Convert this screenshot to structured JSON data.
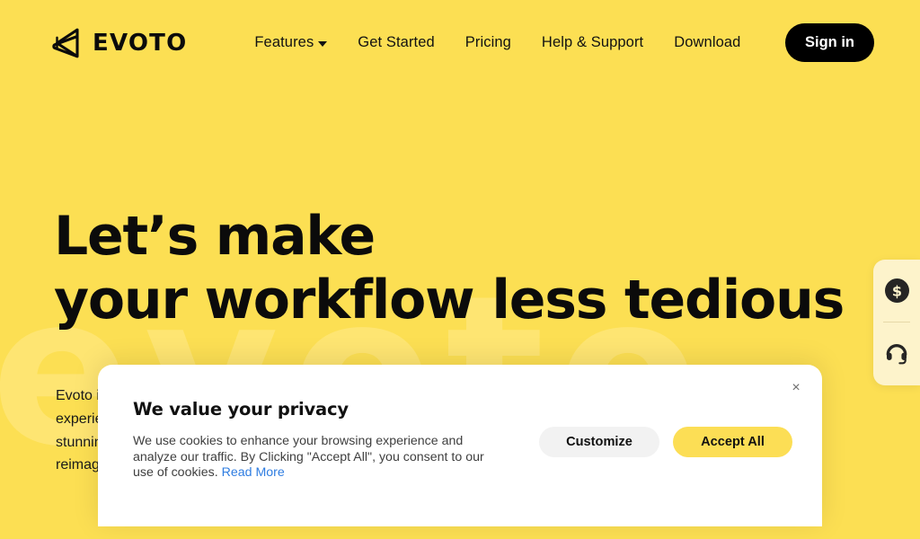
{
  "theme": {
    "brand_yellow": "#FCDF53",
    "watermark_yellow": "#FFE87D",
    "ink": "#0B0B0B",
    "link_blue": "#2F7DE1",
    "dock_cream": "#FDF3CB",
    "accept_yellow": "#FCDE55",
    "customize_grey": "#F2F2F2"
  },
  "background": {
    "watermark_text": "evoto"
  },
  "header": {
    "logo_text": "EVOTO",
    "logo_icon": "evoto-butterfly-mark",
    "nav": [
      {
        "label": "Features",
        "has_caret": true
      },
      {
        "label": "Get Started",
        "has_caret": false
      },
      {
        "label": "Pricing",
        "has_caret": false
      },
      {
        "label": "Help & Support",
        "has_caret": false
      },
      {
        "label": "Download",
        "has_caret": false
      }
    ],
    "signin_label": "Sign in"
  },
  "hero": {
    "line1": "Let’s make",
    "line2a": "your workflow",
    "line2b": "less tedious",
    "paragraph": "Evoto is an AI photo editor that redefines the photo editing experience, creating an enjoyable environment to generate stunning results and process photos in an instant — reality reimagined."
  },
  "side_dock": {
    "items": [
      {
        "icon": "dollar-circle-icon",
        "name": "pricing"
      },
      {
        "icon": "headset-icon",
        "name": "support"
      }
    ]
  },
  "cookie_banner": {
    "title": "We value your privacy",
    "body": "We use cookies to enhance your browsing experience and analyze our traffic. By Clicking \"Accept All\", you consent to our use of cookies. ",
    "link_label": "Read More",
    "customize_label": "Customize",
    "accept_label": "Accept All",
    "close_glyph": "×"
  }
}
